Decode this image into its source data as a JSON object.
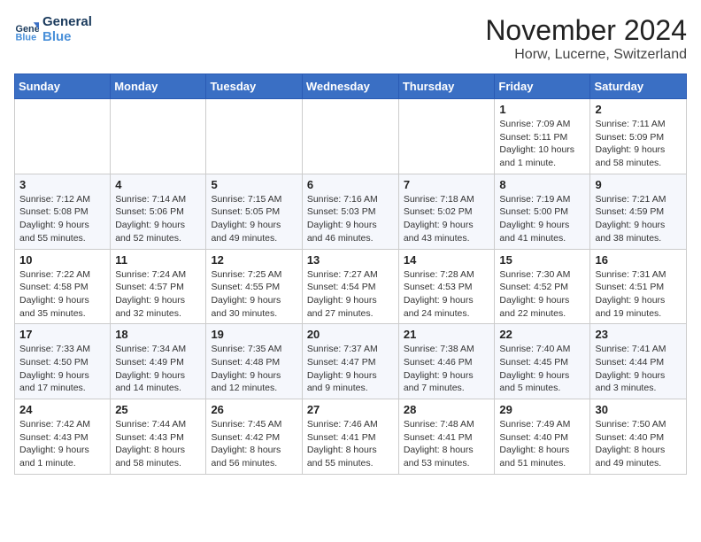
{
  "logo": {
    "line1": "General",
    "line2": "Blue"
  },
  "title": "November 2024",
  "location": "Horw, Lucerne, Switzerland",
  "weekdays": [
    "Sunday",
    "Monday",
    "Tuesday",
    "Wednesday",
    "Thursday",
    "Friday",
    "Saturday"
  ],
  "weeks": [
    [
      {
        "day": "",
        "info": ""
      },
      {
        "day": "",
        "info": ""
      },
      {
        "day": "",
        "info": ""
      },
      {
        "day": "",
        "info": ""
      },
      {
        "day": "",
        "info": ""
      },
      {
        "day": "1",
        "info": "Sunrise: 7:09 AM\nSunset: 5:11 PM\nDaylight: 10 hours and 1 minute."
      },
      {
        "day": "2",
        "info": "Sunrise: 7:11 AM\nSunset: 5:09 PM\nDaylight: 9 hours and 58 minutes."
      }
    ],
    [
      {
        "day": "3",
        "info": "Sunrise: 7:12 AM\nSunset: 5:08 PM\nDaylight: 9 hours and 55 minutes."
      },
      {
        "day": "4",
        "info": "Sunrise: 7:14 AM\nSunset: 5:06 PM\nDaylight: 9 hours and 52 minutes."
      },
      {
        "day": "5",
        "info": "Sunrise: 7:15 AM\nSunset: 5:05 PM\nDaylight: 9 hours and 49 minutes."
      },
      {
        "day": "6",
        "info": "Sunrise: 7:16 AM\nSunset: 5:03 PM\nDaylight: 9 hours and 46 minutes."
      },
      {
        "day": "7",
        "info": "Sunrise: 7:18 AM\nSunset: 5:02 PM\nDaylight: 9 hours and 43 minutes."
      },
      {
        "day": "8",
        "info": "Sunrise: 7:19 AM\nSunset: 5:00 PM\nDaylight: 9 hours and 41 minutes."
      },
      {
        "day": "9",
        "info": "Sunrise: 7:21 AM\nSunset: 4:59 PM\nDaylight: 9 hours and 38 minutes."
      }
    ],
    [
      {
        "day": "10",
        "info": "Sunrise: 7:22 AM\nSunset: 4:58 PM\nDaylight: 9 hours and 35 minutes."
      },
      {
        "day": "11",
        "info": "Sunrise: 7:24 AM\nSunset: 4:57 PM\nDaylight: 9 hours and 32 minutes."
      },
      {
        "day": "12",
        "info": "Sunrise: 7:25 AM\nSunset: 4:55 PM\nDaylight: 9 hours and 30 minutes."
      },
      {
        "day": "13",
        "info": "Sunrise: 7:27 AM\nSunset: 4:54 PM\nDaylight: 9 hours and 27 minutes."
      },
      {
        "day": "14",
        "info": "Sunrise: 7:28 AM\nSunset: 4:53 PM\nDaylight: 9 hours and 24 minutes."
      },
      {
        "day": "15",
        "info": "Sunrise: 7:30 AM\nSunset: 4:52 PM\nDaylight: 9 hours and 22 minutes."
      },
      {
        "day": "16",
        "info": "Sunrise: 7:31 AM\nSunset: 4:51 PM\nDaylight: 9 hours and 19 minutes."
      }
    ],
    [
      {
        "day": "17",
        "info": "Sunrise: 7:33 AM\nSunset: 4:50 PM\nDaylight: 9 hours and 17 minutes."
      },
      {
        "day": "18",
        "info": "Sunrise: 7:34 AM\nSunset: 4:49 PM\nDaylight: 9 hours and 14 minutes."
      },
      {
        "day": "19",
        "info": "Sunrise: 7:35 AM\nSunset: 4:48 PM\nDaylight: 9 hours and 12 minutes."
      },
      {
        "day": "20",
        "info": "Sunrise: 7:37 AM\nSunset: 4:47 PM\nDaylight: 9 hours and 9 minutes."
      },
      {
        "day": "21",
        "info": "Sunrise: 7:38 AM\nSunset: 4:46 PM\nDaylight: 9 hours and 7 minutes."
      },
      {
        "day": "22",
        "info": "Sunrise: 7:40 AM\nSunset: 4:45 PM\nDaylight: 9 hours and 5 minutes."
      },
      {
        "day": "23",
        "info": "Sunrise: 7:41 AM\nSunset: 4:44 PM\nDaylight: 9 hours and 3 minutes."
      }
    ],
    [
      {
        "day": "24",
        "info": "Sunrise: 7:42 AM\nSunset: 4:43 PM\nDaylight: 9 hours and 1 minute."
      },
      {
        "day": "25",
        "info": "Sunrise: 7:44 AM\nSunset: 4:43 PM\nDaylight: 8 hours and 58 minutes."
      },
      {
        "day": "26",
        "info": "Sunrise: 7:45 AM\nSunset: 4:42 PM\nDaylight: 8 hours and 56 minutes."
      },
      {
        "day": "27",
        "info": "Sunrise: 7:46 AM\nSunset: 4:41 PM\nDaylight: 8 hours and 55 minutes."
      },
      {
        "day": "28",
        "info": "Sunrise: 7:48 AM\nSunset: 4:41 PM\nDaylight: 8 hours and 53 minutes."
      },
      {
        "day": "29",
        "info": "Sunrise: 7:49 AM\nSunset: 4:40 PM\nDaylight: 8 hours and 51 minutes."
      },
      {
        "day": "30",
        "info": "Sunrise: 7:50 AM\nSunset: 4:40 PM\nDaylight: 8 hours and 49 minutes."
      }
    ]
  ]
}
